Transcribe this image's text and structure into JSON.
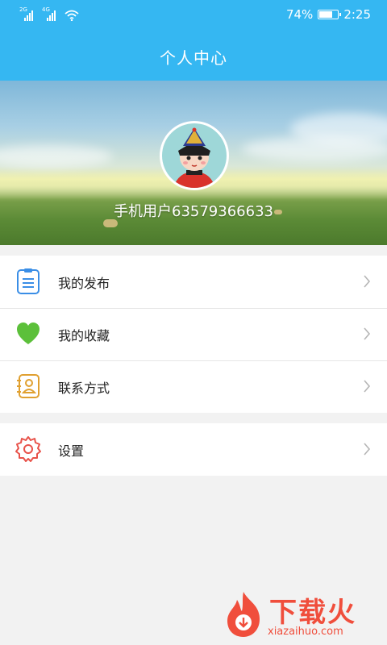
{
  "status_bar": {
    "signal_1_tag": "2G",
    "signal_2_tag": "4G",
    "battery": "74%",
    "battery_level": 0.74,
    "time": "2:25"
  },
  "header": {
    "title": "个人中心"
  },
  "profile": {
    "username": "手机用户63579366633"
  },
  "menu": {
    "items": [
      {
        "label": "我的发布",
        "icon": "clipboard-icon",
        "color": "#3a8ee6"
      },
      {
        "label": "我的收藏",
        "icon": "heart-icon",
        "color": "#5cc03a"
      },
      {
        "label": "联系方式",
        "icon": "contact-book-icon",
        "color": "#e0a030"
      }
    ],
    "settings": {
      "label": "设置",
      "icon": "gear-icon",
      "color": "#e8524a"
    }
  },
  "watermark": {
    "brand": "下载火",
    "site": "xiazaihuo.com"
  },
  "colors": {
    "accent": "#35b7f2",
    "chevron": "#b5b5b5",
    "watermark": "#f04e3c"
  }
}
